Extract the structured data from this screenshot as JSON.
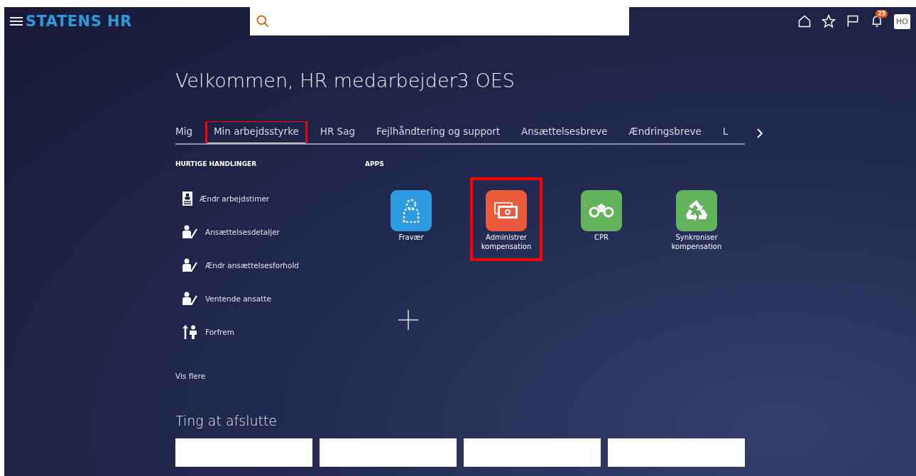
{
  "header": {
    "brand": "STATENS HR",
    "notifications": "25",
    "avatar": "HO"
  },
  "welcome": "Velkommen, HR medarbejder3 OES",
  "tabs": [
    {
      "label": "Mig",
      "selected": false,
      "highlighted": false
    },
    {
      "label": "Min arbejdsstyrke",
      "selected": true,
      "highlighted": true
    },
    {
      "label": "HR Sag",
      "selected": false,
      "highlighted": false
    },
    {
      "label": "Fejlhåndtering og support",
      "selected": false,
      "highlighted": false
    },
    {
      "label": "Ansættelsesbreve",
      "selected": false,
      "highlighted": false
    },
    {
      "label": "Ændringsbreve",
      "selected": false,
      "highlighted": false
    },
    {
      "label": "L",
      "selected": false,
      "highlighted": false
    }
  ],
  "quick_actions": {
    "title": "HURTIGE HANDLINGER",
    "items": [
      {
        "label": "Ændr arbejdstimer",
        "kind": "badge"
      },
      {
        "label": "Ansættelsesdetaljer",
        "kind": "edit"
      },
      {
        "label": "Ændr ansættelsesforhold",
        "kind": "edit"
      },
      {
        "label": "Ventende ansatte",
        "kind": "edit"
      },
      {
        "label": "Forfrem",
        "kind": "promote"
      }
    ],
    "more": "Vis flere"
  },
  "apps": {
    "title": "APPS",
    "items": [
      {
        "label": "Fravær",
        "kind": "person",
        "color": "#2e9be0",
        "highlighted": false
      },
      {
        "label": "Administrer kompensation",
        "kind": "money",
        "color": "#e95b3a",
        "highlighted": true
      },
      {
        "label": "CPR",
        "kind": "binoculars",
        "color": "#62b35b",
        "highlighted": false
      },
      {
        "label": "Synkroniser kompensation",
        "kind": "recycle",
        "color": "#62b35b",
        "highlighted": false
      }
    ]
  },
  "things_to_finish": {
    "title": "Ting at afslutte",
    "cards": [
      {
        "kind": "blank"
      },
      {
        "kind": "blank"
      },
      {
        "kind": "blank"
      },
      {
        "kind": "blank"
      }
    ]
  }
}
